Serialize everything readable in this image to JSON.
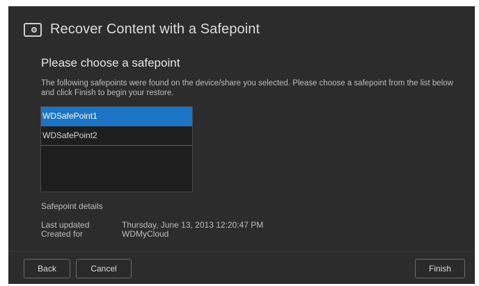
{
  "dialog": {
    "title": "Recover Content with a Safepoint",
    "title_icon": "safe-icon",
    "subtitle": "Please choose a safepoint",
    "description": "The following safepoints were found on the device/share you selected. Please choose a safepoint from the list below and click Finish to begin your restore.",
    "safepoints": [
      {
        "label": "WDSafePoint1",
        "selected": true
      },
      {
        "label": "WDSafePoint2",
        "selected": false
      }
    ],
    "details": {
      "heading": "Safepoint details",
      "last_updated_label": "Last updated",
      "last_updated_value": "Thursday, June 13, 2013 12:20:47 PM",
      "created_for_label": "Created for",
      "created_for_value": "WDMyCloud"
    },
    "buttons": {
      "back": "Back",
      "cancel": "Cancel",
      "finish": "Finish"
    }
  },
  "colors": {
    "background": "#2c2c2c",
    "selection": "#1b74c5",
    "text": "#dcdcdc"
  }
}
